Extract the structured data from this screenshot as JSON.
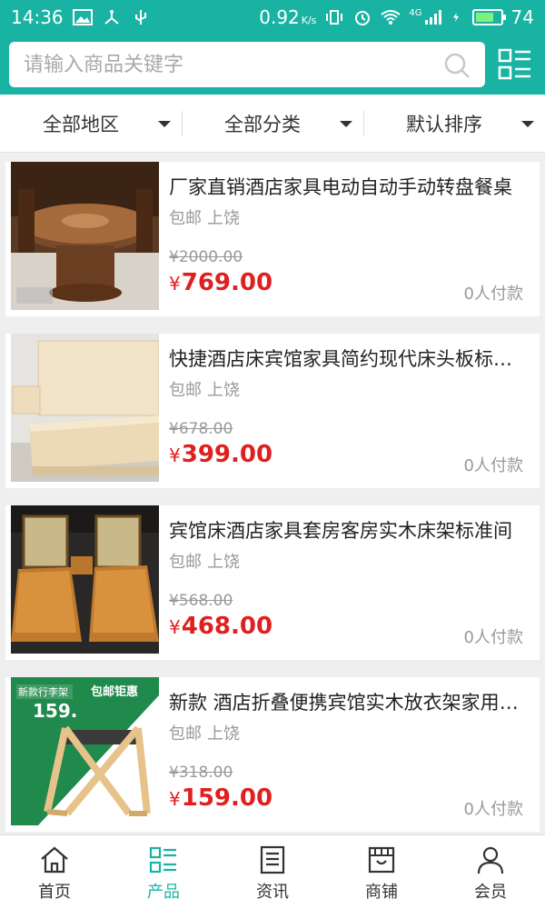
{
  "status_bar": {
    "time": "14:36",
    "speed": "0.92",
    "speed_unit": "K/s",
    "network": "4G",
    "battery": "74"
  },
  "search": {
    "placeholder": "请输入商品关键字"
  },
  "filters": [
    {
      "label": "全部地区"
    },
    {
      "label": "全部分类"
    },
    {
      "label": "默认排序"
    }
  ],
  "products": [
    {
      "title": "厂家直销酒店家具电动自动手动转盘餐桌",
      "shipping": "包邮",
      "location": "上饶",
      "original_price": "¥2000.00",
      "currency": "¥",
      "price": "769.00",
      "paid": "0人付款"
    },
    {
      "title": "快捷酒店床宾馆家具简约现代床头板标准间",
      "shipping": "包邮",
      "location": "上饶",
      "original_price": "¥678.00",
      "currency": "¥",
      "price": "399.00",
      "paid": "0人付款"
    },
    {
      "title": "宾馆床酒店家具套房客房实木床架标准间",
      "shipping": "包邮",
      "location": "上饶",
      "original_price": "¥568.00",
      "currency": "¥",
      "price": "468.00",
      "paid": "0人付款"
    },
    {
      "title": "新款 酒店折叠便携宾馆实木放衣架家用行李架",
      "shipping": "包邮",
      "location": "上饶",
      "original_price": "¥318.00",
      "currency": "¥",
      "price": "159.00",
      "paid": "0人付款",
      "badge_text": "新款行李架",
      "badge_price": "159.",
      "badge_promo": "包邮钜惠"
    }
  ],
  "tabs": [
    {
      "label": "首页",
      "icon": "home-icon"
    },
    {
      "label": "产品",
      "icon": "products-icon",
      "active": true
    },
    {
      "label": "资讯",
      "icon": "news-icon"
    },
    {
      "label": "商铺",
      "icon": "shop-icon"
    },
    {
      "label": "会员",
      "icon": "member-icon"
    }
  ],
  "colors": {
    "accent": "#19b3a3",
    "price": "#e02020"
  }
}
